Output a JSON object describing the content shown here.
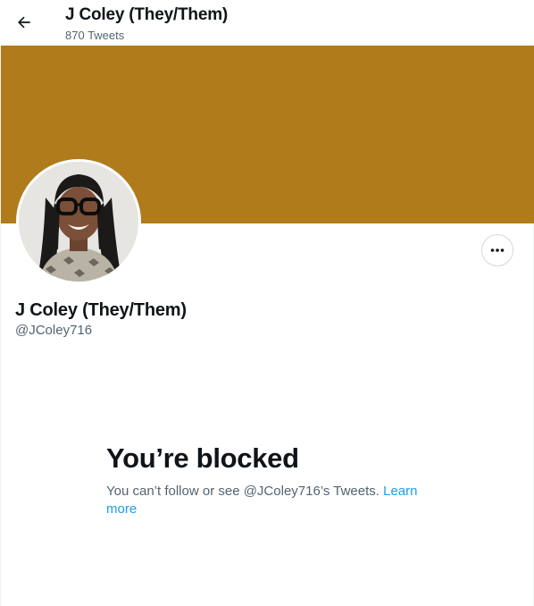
{
  "colors": {
    "banner": "#b07b1b",
    "accent_link": "#1d9bf0",
    "secondary_text": "#536471",
    "primary_text": "#0f1419"
  },
  "header": {
    "back_icon": "arrow-left-icon",
    "title": "J Coley (They/Them)",
    "tweet_count": "870 Tweets"
  },
  "profile": {
    "display_name": "J Coley (They/Them)",
    "handle": "@JColey716",
    "more_icon": "more-horizontal-icon"
  },
  "blocked": {
    "title": "You’re blocked",
    "message": "You can’t follow or see @JColey716’s Tweets. ",
    "link_text": "Learn more"
  }
}
